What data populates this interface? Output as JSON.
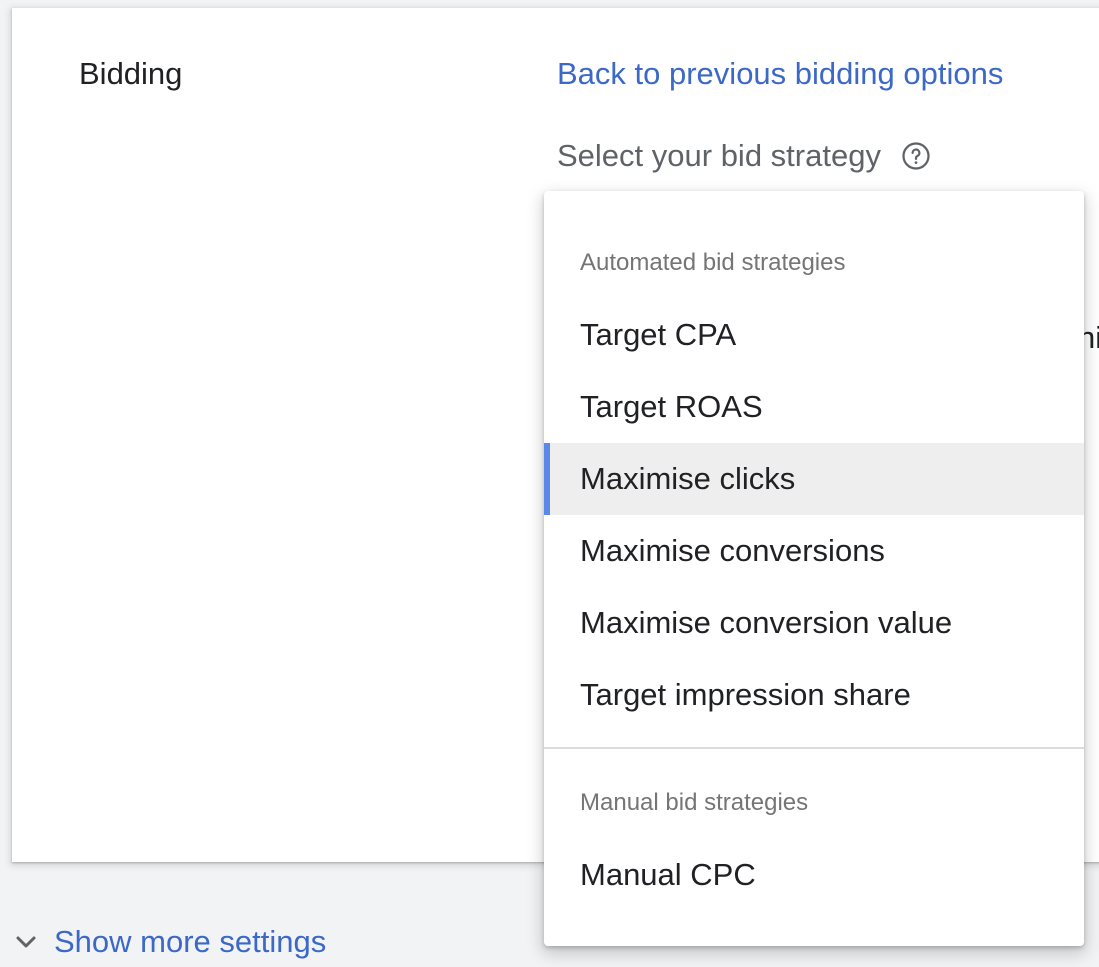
{
  "section": {
    "title": "Bidding",
    "back_link": "Back to previous bidding options",
    "strategy_label": "Select your bid strategy",
    "help_icon": "help-circle-icon",
    "obscured_text_fragment": "ni"
  },
  "dropdown": {
    "groups": [
      {
        "label": "Automated bid strategies",
        "items": [
          {
            "label": "Target CPA",
            "selected": false
          },
          {
            "label": "Target ROAS",
            "selected": false
          },
          {
            "label": "Maximise clicks",
            "selected": true
          },
          {
            "label": "Maximise conversions",
            "selected": false
          },
          {
            "label": "Maximise conversion value",
            "selected": false
          },
          {
            "label": "Target impression share",
            "selected": false
          }
        ]
      },
      {
        "label": "Manual bid strategies",
        "items": [
          {
            "label": "Manual CPC",
            "selected": false
          }
        ]
      }
    ]
  },
  "footer": {
    "show_more_label": "Show more settings",
    "show_more_icon": "chevron-down-icon"
  },
  "colors": {
    "link": "#3c68c8",
    "selected_indicator": "#5b87e8",
    "selected_background": "#eeeeee",
    "page_background": "#f1f3f4"
  }
}
